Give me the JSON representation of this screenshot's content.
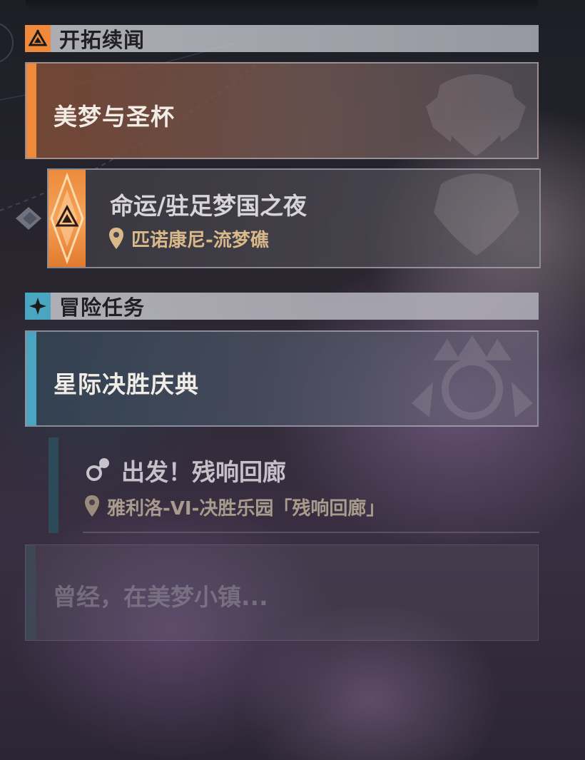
{
  "trailblaze": {
    "section_title": "开拓续闻",
    "quest_title": "美梦与圣杯",
    "mission": {
      "title": "命运/驻足梦国之夜",
      "location": "匹诺康尼-流梦礁"
    }
  },
  "adventure": {
    "section_title": "冒险任务",
    "quest_title": "星际决胜庆典",
    "mission": {
      "title": "出发！残响回廊",
      "location": "雅利洛-VI-决胜乐园「残响回廊」"
    },
    "next_quest_title": "曾经，在美梦小镇..."
  },
  "colors": {
    "trailblaze_accent": "#f08a3a",
    "adventure_accent": "#4aa6c0",
    "location_text": "#d9b98a"
  },
  "icons": [
    "trailblaze-badge-icon",
    "adventure-badge-icon",
    "location-pin-icon",
    "mission-type-icon",
    "tracking-pointer-icon"
  ]
}
